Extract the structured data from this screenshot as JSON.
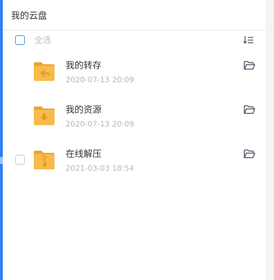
{
  "panel": {
    "title": "我的云盘"
  },
  "toolbar": {
    "select_all_label": "全选",
    "sort_icon": "sort-descending-icon"
  },
  "colors": {
    "accent": "#2f7ef7",
    "folder": "#f7bb4a",
    "folder_dark": "#e9a537"
  },
  "files": [
    {
      "name": "我的转存",
      "date": "2020-07-13 20:09",
      "badge": "arrow-back",
      "checkbox_visible": false
    },
    {
      "name": "我的资源",
      "date": "2020-07-13 20:09",
      "badge": "arrow-down",
      "checkbox_visible": false
    },
    {
      "name": "在线解压",
      "date": "2021-03-03 18:54",
      "badge": "zip",
      "checkbox_visible": true
    }
  ]
}
